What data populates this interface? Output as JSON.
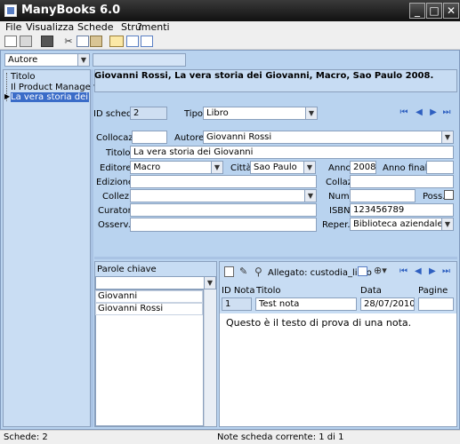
{
  "window": {
    "title": "ManyBooks 6.0",
    "min": "_",
    "max": "□",
    "close": "✕"
  },
  "menu": [
    "File",
    "Visualizza",
    "Schede",
    "Strumenti",
    "?"
  ],
  "sidebar": {
    "filter": "Autore",
    "items": [
      "Titolo",
      "Il Product Manager",
      "La vera storia dei Giov"
    ],
    "selected_index": 2
  },
  "header": {
    "citation": "Giovanni Rossi, La vera storia dei Giovanni, Macro, Sao Paulo 2008."
  },
  "form": {
    "id_label": "ID scheda:",
    "id_value": "2",
    "tipo_label": "Tipo:",
    "tipo_value": "Libro",
    "colloc_label": "Collocaz.:",
    "colloc_value": "",
    "autore_label": "Autore:",
    "autore_value": "Giovanni Rossi",
    "titolo_label": "Titolo:",
    "titolo_value": "La vera storia dei Giovanni",
    "editore_label": "Editore:",
    "editore_value": "Macro",
    "citta_label": "Città:",
    "citta_value": "Sao Paulo",
    "anno_label": "Anno:",
    "anno_value": "2008",
    "anno_finale_label": "Anno finale:",
    "anno_finale_value": "",
    "edizione_label": "Edizione:",
    "edizione_value": "",
    "collaz_label": "Collaz.:",
    "collaz_value": "",
    "collez_label": "Collez.:",
    "collez_value": "",
    "num_label": "Num.:",
    "num_value": "",
    "poss_label": "Poss.:",
    "curatori_label": "Curatori:",
    "curatori_value": "",
    "isbn_label": "ISBN:",
    "isbn_value": "123456789",
    "osserv_label": "Osserv.:",
    "osserv_value": "",
    "reper_label": "Reper.:",
    "reper_value": "Biblioteca aziendale"
  },
  "keywords": {
    "title": "Parole chiave",
    "input_value": "",
    "items": [
      "Giovanni",
      "Giovanni Rossi"
    ]
  },
  "notes": {
    "attachment_label": "Allegato: custodia_libro",
    "columns": [
      "ID Nota",
      "Titolo",
      "Data",
      "Pagine"
    ],
    "row": [
      "1",
      "Test nota",
      "28/07/2010",
      ""
    ],
    "body": "Questo è il testo di prova di una nota."
  },
  "status": {
    "left": "Schede: 2",
    "right": "Note scheda corrente: 1 di 1"
  },
  "colors": {
    "panel": "#b9d3ef",
    "titlebar": "#1e1e1e",
    "nav": "#2e5fc0"
  }
}
